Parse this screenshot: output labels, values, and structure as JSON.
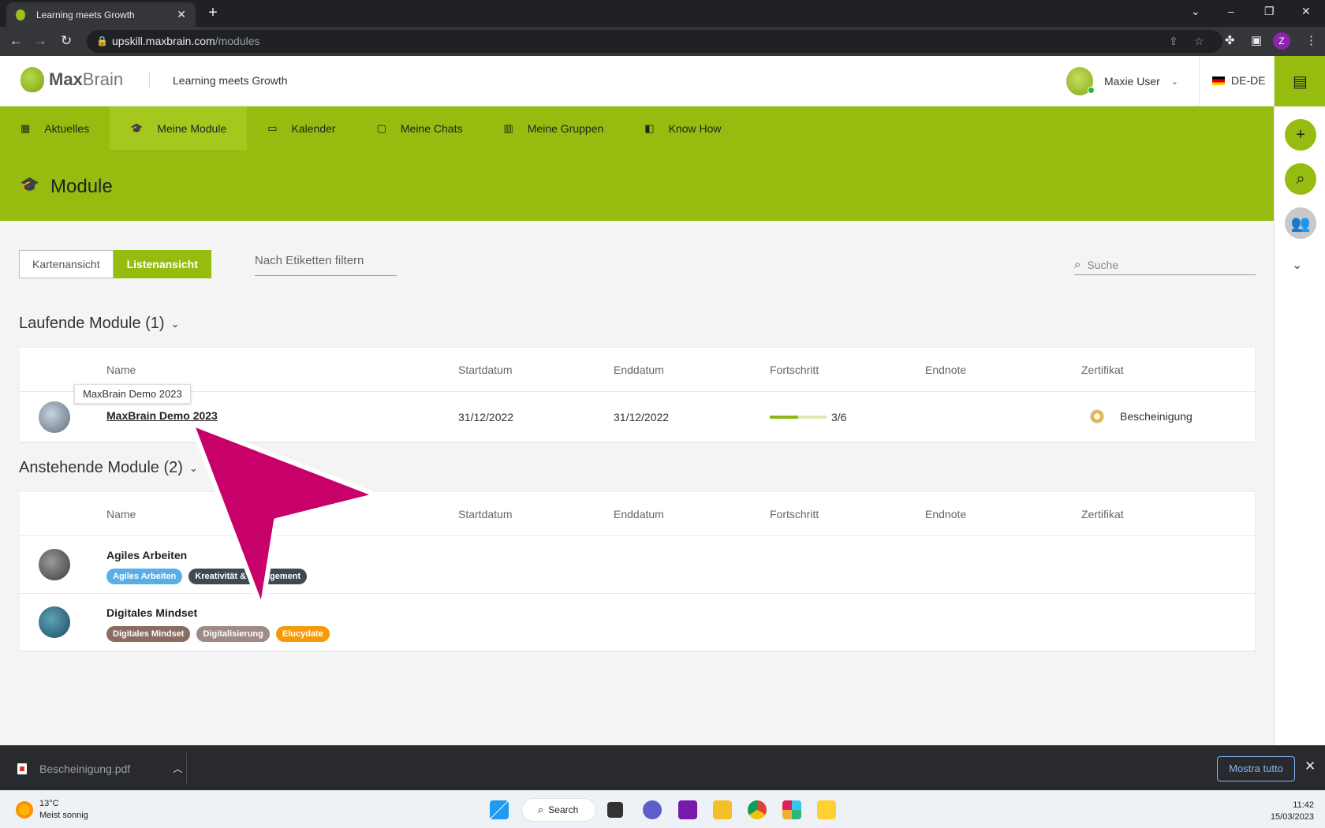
{
  "browser": {
    "tab_title": "Learning meets Growth",
    "url_host": "upskill.maxbrain.com",
    "url_path": "/modules",
    "profile_initial": "Z"
  },
  "header": {
    "logo_bold": "Max",
    "logo_rest": "Brain",
    "tagline": "Learning meets Growth",
    "user_name": "Maxie User",
    "language": "DE-DE"
  },
  "nav": {
    "items": [
      {
        "label": "Aktuelles",
        "icon": "news-icon"
      },
      {
        "label": "Meine Module",
        "icon": "graduation-cap-icon"
      },
      {
        "label": "Kalender",
        "icon": "calendar-icon"
      },
      {
        "label": "Meine Chats",
        "icon": "chat-icon"
      },
      {
        "label": "Meine Gruppen",
        "icon": "groups-icon"
      },
      {
        "label": "Know How",
        "icon": "book-icon"
      }
    ],
    "active_index": 1
  },
  "page": {
    "title": "Module",
    "view_card": "Kartenansicht",
    "view_list": "Listenansicht",
    "filter_placeholder": "Nach Etiketten filtern",
    "search_placeholder": "Suche"
  },
  "columns": {
    "name": "Name",
    "start": "Startdatum",
    "end": "Enddatum",
    "progress": "Fortschritt",
    "grade": "Endnote",
    "certificate": "Zertifikat"
  },
  "running": {
    "title": "Laufende Module (1)",
    "rows": [
      {
        "name": "MaxBrain Demo 2023",
        "tooltip": "MaxBrain Demo 2023",
        "start": "31/12/2022",
        "end": "31/12/2022",
        "progress_label": "3/6",
        "progress_fraction": 0.5,
        "certificate": "Bescheinigung"
      }
    ]
  },
  "upcoming": {
    "title": "Anstehende Module (2)",
    "rows": [
      {
        "name": "Agiles Arbeiten",
        "tags": [
          {
            "label": "Agiles Arbeiten",
            "color": "#5aaee8"
          },
          {
            "label": "Kreativität & Engagement",
            "color": "#3d4a52"
          }
        ]
      },
      {
        "name": "Digitales Mindset",
        "tags": [
          {
            "label": "Digitales Mindset",
            "color": "#8a6d62"
          },
          {
            "label": "Digitalisierung",
            "color": "#a08a84"
          },
          {
            "label": "Elucydate",
            "color": "#f59b0b"
          }
        ]
      }
    ]
  },
  "downloads": {
    "file": "Bescheinigung.pdf",
    "show_all": "Mostra tutto"
  },
  "taskbar": {
    "temperature": "13°C",
    "weather": "Meist sonnig",
    "search": "Search",
    "time": "11:42",
    "date": "15/03/2023"
  },
  "colors": {
    "brand": "#96bc0f",
    "pointer": "#c8006a"
  }
}
